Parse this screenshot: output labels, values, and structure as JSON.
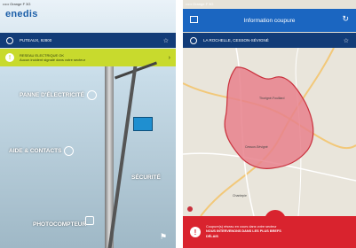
{
  "left": {
    "status": {
      "carrier": "••••• Orange F  3G",
      "time": ""
    },
    "logo": {
      "brand": "enedis"
    },
    "location": {
      "city": "PUTEAUX, 92800"
    },
    "alert": {
      "title": "RESEAU ELECTRIQUE OK",
      "text": "Aucun incident signalé dans votre secteur"
    },
    "menu": {
      "panne": "PANNE D'ÉLECTRICITÉ",
      "aide": "AIDE & CONTACTS",
      "securite": "SÉCURITÉ",
      "photo": "PHOTOCOMPTEUR"
    }
  },
  "right": {
    "status": {
      "carrier": "••••• Orange F  3G",
      "time": ""
    },
    "header": {
      "title": "Information coupure"
    },
    "location": {
      "city": "LA ROCHELLE, CESSON-SÉVIGNÉ"
    },
    "map_labels": {
      "a": "Cesson-Sévigné",
      "b": "Chantepie",
      "c": "Thorigné-Fouillard"
    },
    "banner": {
      "line1": "Coupure(s) réseau en cours dans votre secteur",
      "line2": "NOUS INTERVENONS DANS LES PLUS BREFS",
      "line3": "DÉLAIS"
    }
  },
  "colors": {
    "brand_blue": "#1b5ea8",
    "header_blue": "#1b66c1",
    "location_bar": "#123c78",
    "alert_green": "#c8da2d",
    "outage_red": "#d9232e",
    "outage_area": "#e8818c"
  },
  "icons": [
    "location-pin-icon",
    "star-icon",
    "warning-icon",
    "chevron-right-icon",
    "lightning-icon",
    "phone-icon",
    "shield-icon",
    "camera-icon",
    "home-icon",
    "refresh-icon"
  ]
}
